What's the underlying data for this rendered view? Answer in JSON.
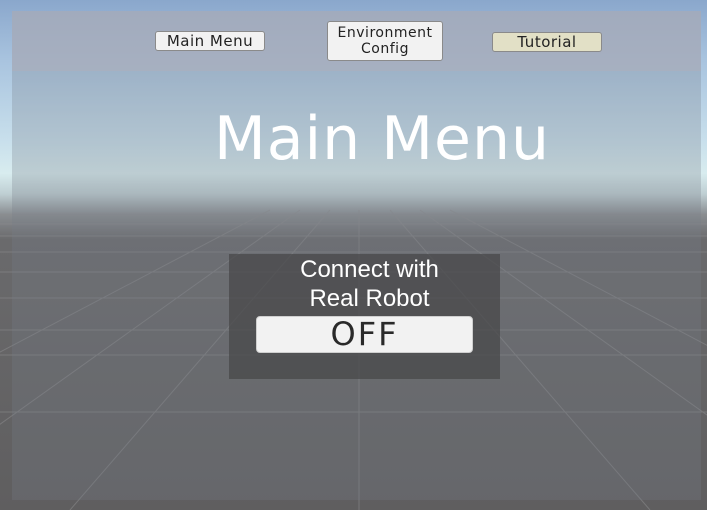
{
  "nav": {
    "main_menu_label": "Main Menu",
    "environment_line1": "Environment",
    "environment_line2": "Config",
    "tutorial_label": "Tutorial"
  },
  "page": {
    "title": "Main Menu"
  },
  "connect": {
    "label_line1": "Connect with",
    "label_line2": "Real Robot",
    "toggle_value": "OFF"
  },
  "colors": {
    "tutorial_button_bg": "#e2e0c6",
    "button_bg": "#f2f2f2",
    "title_text": "#ffffff"
  }
}
